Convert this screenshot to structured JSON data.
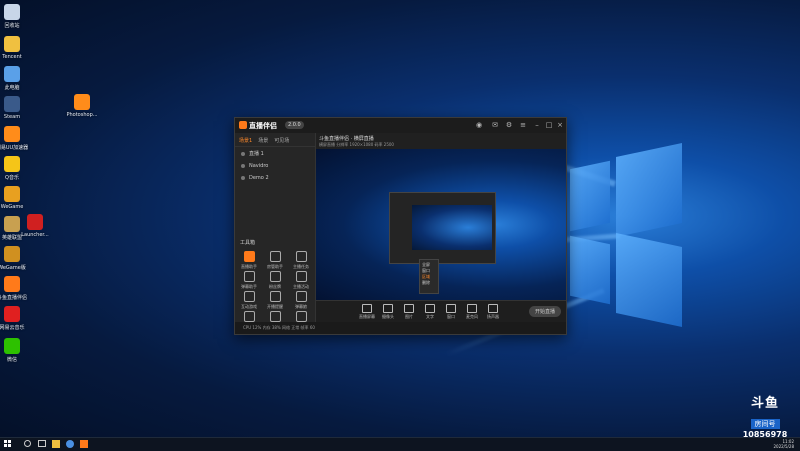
{
  "colors": {
    "accent": "#ff7a1a",
    "wallpaper": "#0a2f6e",
    "app_bg": "#232323"
  },
  "desktop_icons": [
    {
      "label": "回收站",
      "icon": "recycle-bin-icon",
      "color": "#c8d6e8"
    },
    {
      "label": "Tencent",
      "icon": "folder-icon",
      "color": "#f0c040"
    },
    {
      "label": "此电脑",
      "icon": "computer-icon",
      "color": "#5aa0e8"
    },
    {
      "label": "Steam",
      "icon": "steam-icon",
      "color": "#3a5a8a"
    },
    {
      "label": "网易UU加速器",
      "icon": "vlc-icon",
      "color": "#ff8c1a"
    },
    {
      "label": "Q音乐",
      "icon": "qmusic-icon",
      "color": "#f5c518"
    },
    {
      "label": "WeGame",
      "icon": "wegame-icon",
      "color": "#e8a020"
    },
    {
      "label": "英雄联盟",
      "icon": "lol-icon",
      "color": "#c8a050"
    },
    {
      "label": "WeGame版",
      "icon": "wegame2-icon",
      "color": "#d09020"
    },
    {
      "label": "斗鱼直播伴侣",
      "icon": "douyu-companion-icon",
      "color": "#ff7a1a"
    },
    {
      "label": "网易云音乐",
      "icon": "netease-music-icon",
      "color": "#e02020"
    },
    {
      "label": "微信",
      "icon": "wechat-icon",
      "color": "#2dc100"
    }
  ],
  "desktop_icons_col2": [
    {
      "label": "Photoshop...",
      "icon": "vlc-icon-2",
      "color": "#ff8c1a"
    },
    {
      "label": "Launcher...",
      "icon": "launcher-icon",
      "color": "#d02020"
    }
  ],
  "app": {
    "logo": "直播伴侣",
    "version": "2.0.0",
    "tabs": [
      "场景1",
      "场景",
      "可见场"
    ],
    "scenes": [
      "直播 1",
      "Navidro",
      "Demo 2"
    ],
    "tools_heading": "工具箱",
    "tools": [
      "直播助手",
      "房管助手",
      "主播任务",
      "弹幕助手",
      "粉丝牌",
      "主播活动",
      "互动游戏",
      "开播提醒",
      "弹幕娘",
      "连麦",
      "PK",
      "更多"
    ],
    "preview_title": "斗鱼直播伴侣 · 横屏直播",
    "preview_sub": "横屏直播   分辨率 1920×1080   码率 2500",
    "bottom": [
      "直播屏幕",
      "摄像头",
      "图片",
      "文字",
      "窗口",
      "麦克风",
      "扬声器"
    ],
    "go_live": "开始直播",
    "context_menu": [
      "全屏",
      "窗口",
      "区域",
      "删除"
    ],
    "status_text": "CPU 12%   内存 38%   网络 正常   帧率 60"
  },
  "taskbar": {
    "time": "11:02",
    "date": "2022/5/28"
  },
  "badge": {
    "logo": "斗鱼",
    "label": "房间号",
    "room": "10856978"
  }
}
